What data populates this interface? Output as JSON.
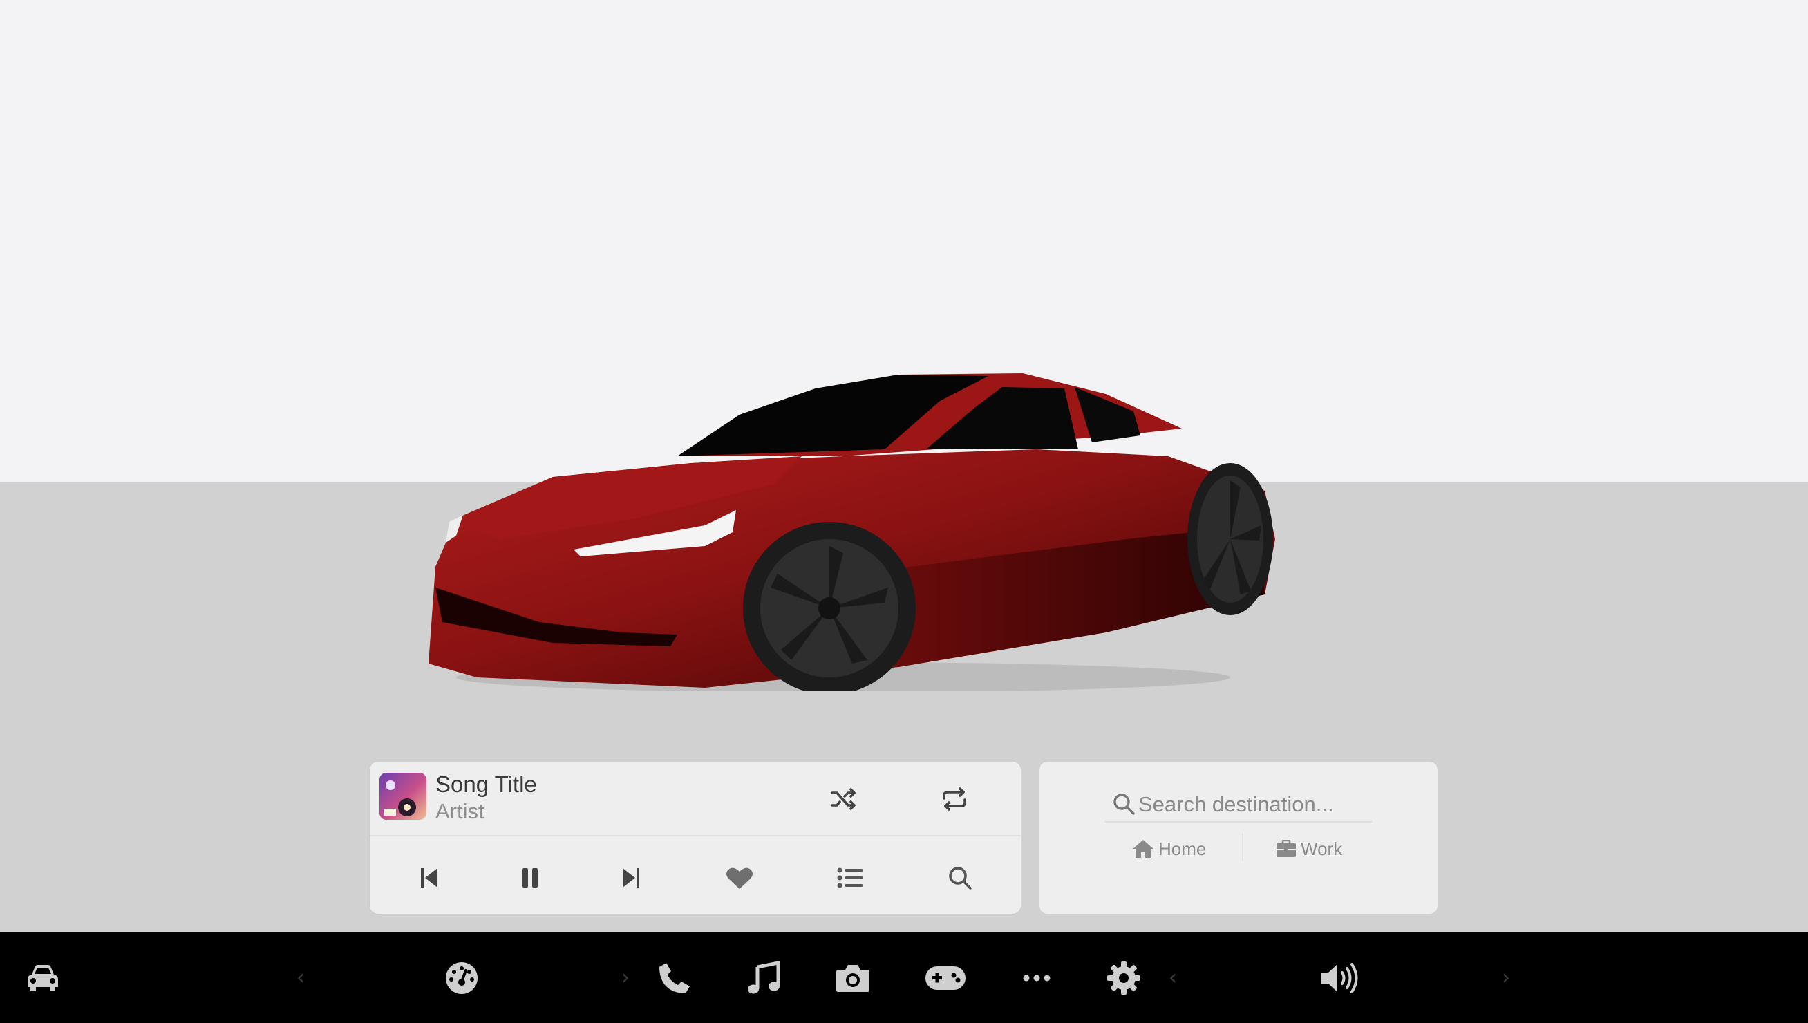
{
  "music": {
    "song_title": "Song Title",
    "artist": "Artist",
    "controls": {
      "shuffle": "shuffle-icon",
      "repeat": "repeat-icon",
      "previous": "skip-previous-icon",
      "pause": "pause-icon",
      "next": "skip-next-icon",
      "like": "heart-icon",
      "queue": "list-icon",
      "search": "search-icon"
    }
  },
  "navigation": {
    "search_placeholder": "Search destination...",
    "home_label": "Home",
    "work_label": "Work"
  },
  "taskbar": {
    "items": [
      "car-icon",
      "dashboard-icon",
      "phone-icon",
      "music-icon",
      "camera-icon",
      "gamepad-icon",
      "more-icon",
      "settings-icon",
      "volume-icon"
    ],
    "chevron_left": "‹",
    "chevron_right": "›"
  },
  "colors": {
    "car_body": "#8e1414",
    "sky": "#f3f3f5",
    "ground": "#d1d1d1",
    "card": "#efeeee",
    "taskbar": "#000000"
  }
}
